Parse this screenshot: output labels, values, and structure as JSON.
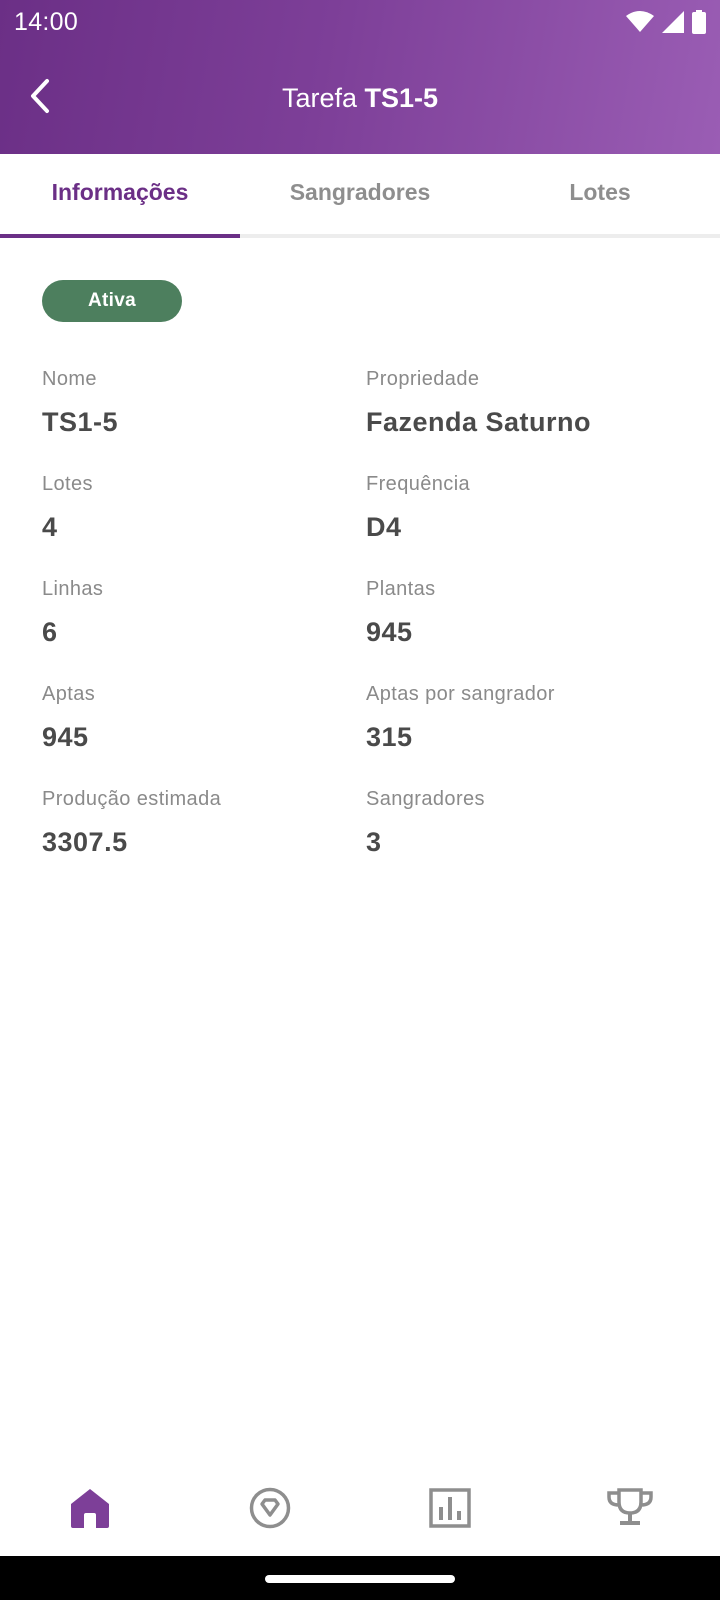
{
  "status_bar": {
    "time": "14:00",
    "icons": [
      "wifi-icon",
      "cellular-signal-icon",
      "battery-icon"
    ]
  },
  "header": {
    "title_prefix": "Tarefa",
    "title_code": "TS1-5",
    "back_icon": "chevron-left-icon"
  },
  "tabs": [
    {
      "label": "Informações",
      "active": true
    },
    {
      "label": "Sangradores",
      "active": false
    },
    {
      "label": "Lotes",
      "active": false
    }
  ],
  "status_badge": {
    "label": "Ativa"
  },
  "info": {
    "nome": {
      "label": "Nome",
      "value": "TS1-5"
    },
    "propriedade": {
      "label": "Propriedade",
      "value": "Fazenda Saturno"
    },
    "lotes": {
      "label": "Lotes",
      "value": "4"
    },
    "frequencia": {
      "label": "Frequência",
      "value": "D4"
    },
    "linhas": {
      "label": "Linhas",
      "value": "6"
    },
    "plantas": {
      "label": "Plantas",
      "value": "945"
    },
    "aptas": {
      "label": "Aptas",
      "value": "945"
    },
    "aptas_por_sangrador": {
      "label": "Aptas por sangrador",
      "value": "315"
    },
    "producao_estimada": {
      "label": "Produção estimada",
      "value": "3307.5"
    },
    "sangradores": {
      "label": "Sangradores",
      "value": "3"
    }
  },
  "bottom_nav": [
    {
      "icon": "home-icon",
      "active": true
    },
    {
      "icon": "diamond-badge-icon",
      "active": false
    },
    {
      "icon": "bar-chart-icon",
      "active": false
    },
    {
      "icon": "trophy-icon",
      "active": false
    }
  ],
  "colors": {
    "primary": "#6b2f86",
    "header_gradient_end": "#9a5db4",
    "badge_green": "#4d7f5e",
    "inactive_gray": "#8e8e8e",
    "text_dark": "#4a4a4a"
  }
}
